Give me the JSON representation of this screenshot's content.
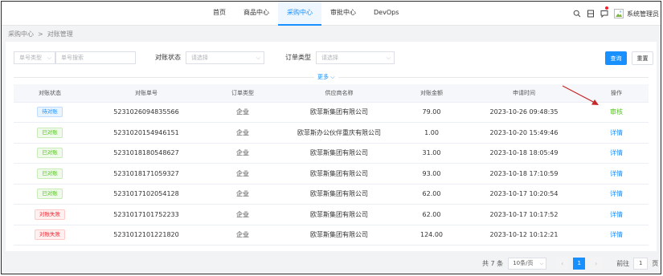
{
  "nav": {
    "items": [
      "首页",
      "商品中心",
      "采购中心",
      "审批中心",
      "DevOps"
    ],
    "user": "系统管理员"
  },
  "breadcrumb": [
    "采购中心",
    "对账管理"
  ],
  "filter": {
    "order_type_select": "单号类型",
    "order_no_placeholder": "单号搜索",
    "status_label": "对账状态",
    "status_placeholder": "请选择",
    "type_label": "订单类型",
    "type_placeholder": "请选择",
    "search": "查询",
    "reset": "重置",
    "more": "更多"
  },
  "table": {
    "headers": [
      "对账状态",
      "对账单号",
      "订单类型",
      "供应商名称",
      "对账金额",
      "申请时间",
      "操作"
    ],
    "rows": [
      {
        "status": "待对账",
        "no": "5231026094835566",
        "type": "企业",
        "supplier": "欧菲斯集团有限公司",
        "amount": "79.00",
        "time": "2023-10-26 09:48:35",
        "action": "审核"
      },
      {
        "status": "已对账",
        "no": "5231020154946151",
        "type": "企业",
        "supplier": "欧菲斯办公伙伴重庆有限公司",
        "amount": "1.00",
        "time": "2023-10-20 15:49:46",
        "action": "详情"
      },
      {
        "status": "已对账",
        "no": "5231018180548627",
        "type": "企业",
        "supplier": "欧菲斯集团有限公司",
        "amount": "31.00",
        "time": "2023-10-18 18:05:49",
        "action": "详情"
      },
      {
        "status": "已对账",
        "no": "5231018171059327",
        "type": "企业",
        "supplier": "欧菲斯集团有限公司",
        "amount": "93.00",
        "time": "2023-10-18 17:10:59",
        "action": "详情"
      },
      {
        "status": "已对账",
        "no": "5231017102054128",
        "type": "企业",
        "supplier": "欧菲斯集团有限公司",
        "amount": "62.00",
        "time": "2023-10-17 10:20:54",
        "action": "详情"
      },
      {
        "status": "对账失败",
        "no": "5231017101752233",
        "type": "企业",
        "supplier": "欧菲斯集团有限公司",
        "amount": "62.00",
        "time": "2023-10-17 10:17:52",
        "action": "详情"
      },
      {
        "status": "对账失败",
        "no": "5231012101221820",
        "type": "企业",
        "supplier": "欧菲斯集团有限公司",
        "amount": "124.00",
        "time": "2023-10-12 10:12:21",
        "action": "详情"
      }
    ]
  },
  "pagination": {
    "total": "共 7 条",
    "page_size": "10条/页",
    "current_page": "1",
    "goto_label": "前往",
    "goto_value": "1",
    "page_unit": "页"
  },
  "colors": {
    "accent": "#1890ff",
    "success": "#52c41a",
    "danger": "#f5222d",
    "annotation_arrow": "#c62828"
  }
}
